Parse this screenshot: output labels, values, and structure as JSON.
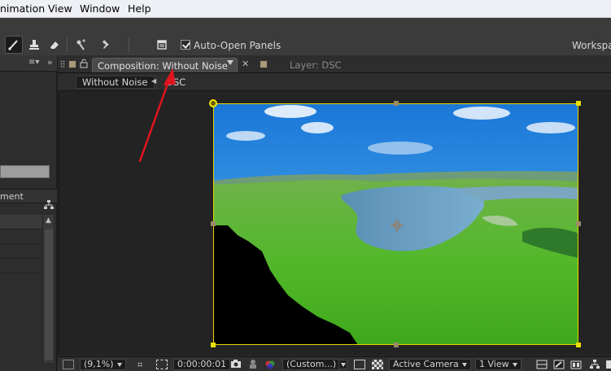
{
  "menubar": {
    "items": [
      {
        "label": "nimation"
      },
      {
        "label": "View"
      },
      {
        "label": "Window"
      },
      {
        "label": "Help"
      }
    ]
  },
  "toolbar": {
    "auto_open_label": "Auto-Open Panels",
    "auto_open_checked": true,
    "workspace_label": "Workspac"
  },
  "left_panel": {
    "header_label": "ment"
  },
  "composition": {
    "active_tab_label": "Composition: Without Noise",
    "layer_tab_label": "Layer: DSC",
    "breadcrumb_current": "Without Noise",
    "breadcrumb_next": "DSC"
  },
  "bottombar": {
    "zoom": "(9,1%)",
    "timecode": "0:00:00:01",
    "resolution": "(Custom...)",
    "camera": "Active Camera",
    "views": "1 View"
  },
  "colors": {
    "annotation_arrow": "#e0141e",
    "selection": "#e8d400"
  }
}
